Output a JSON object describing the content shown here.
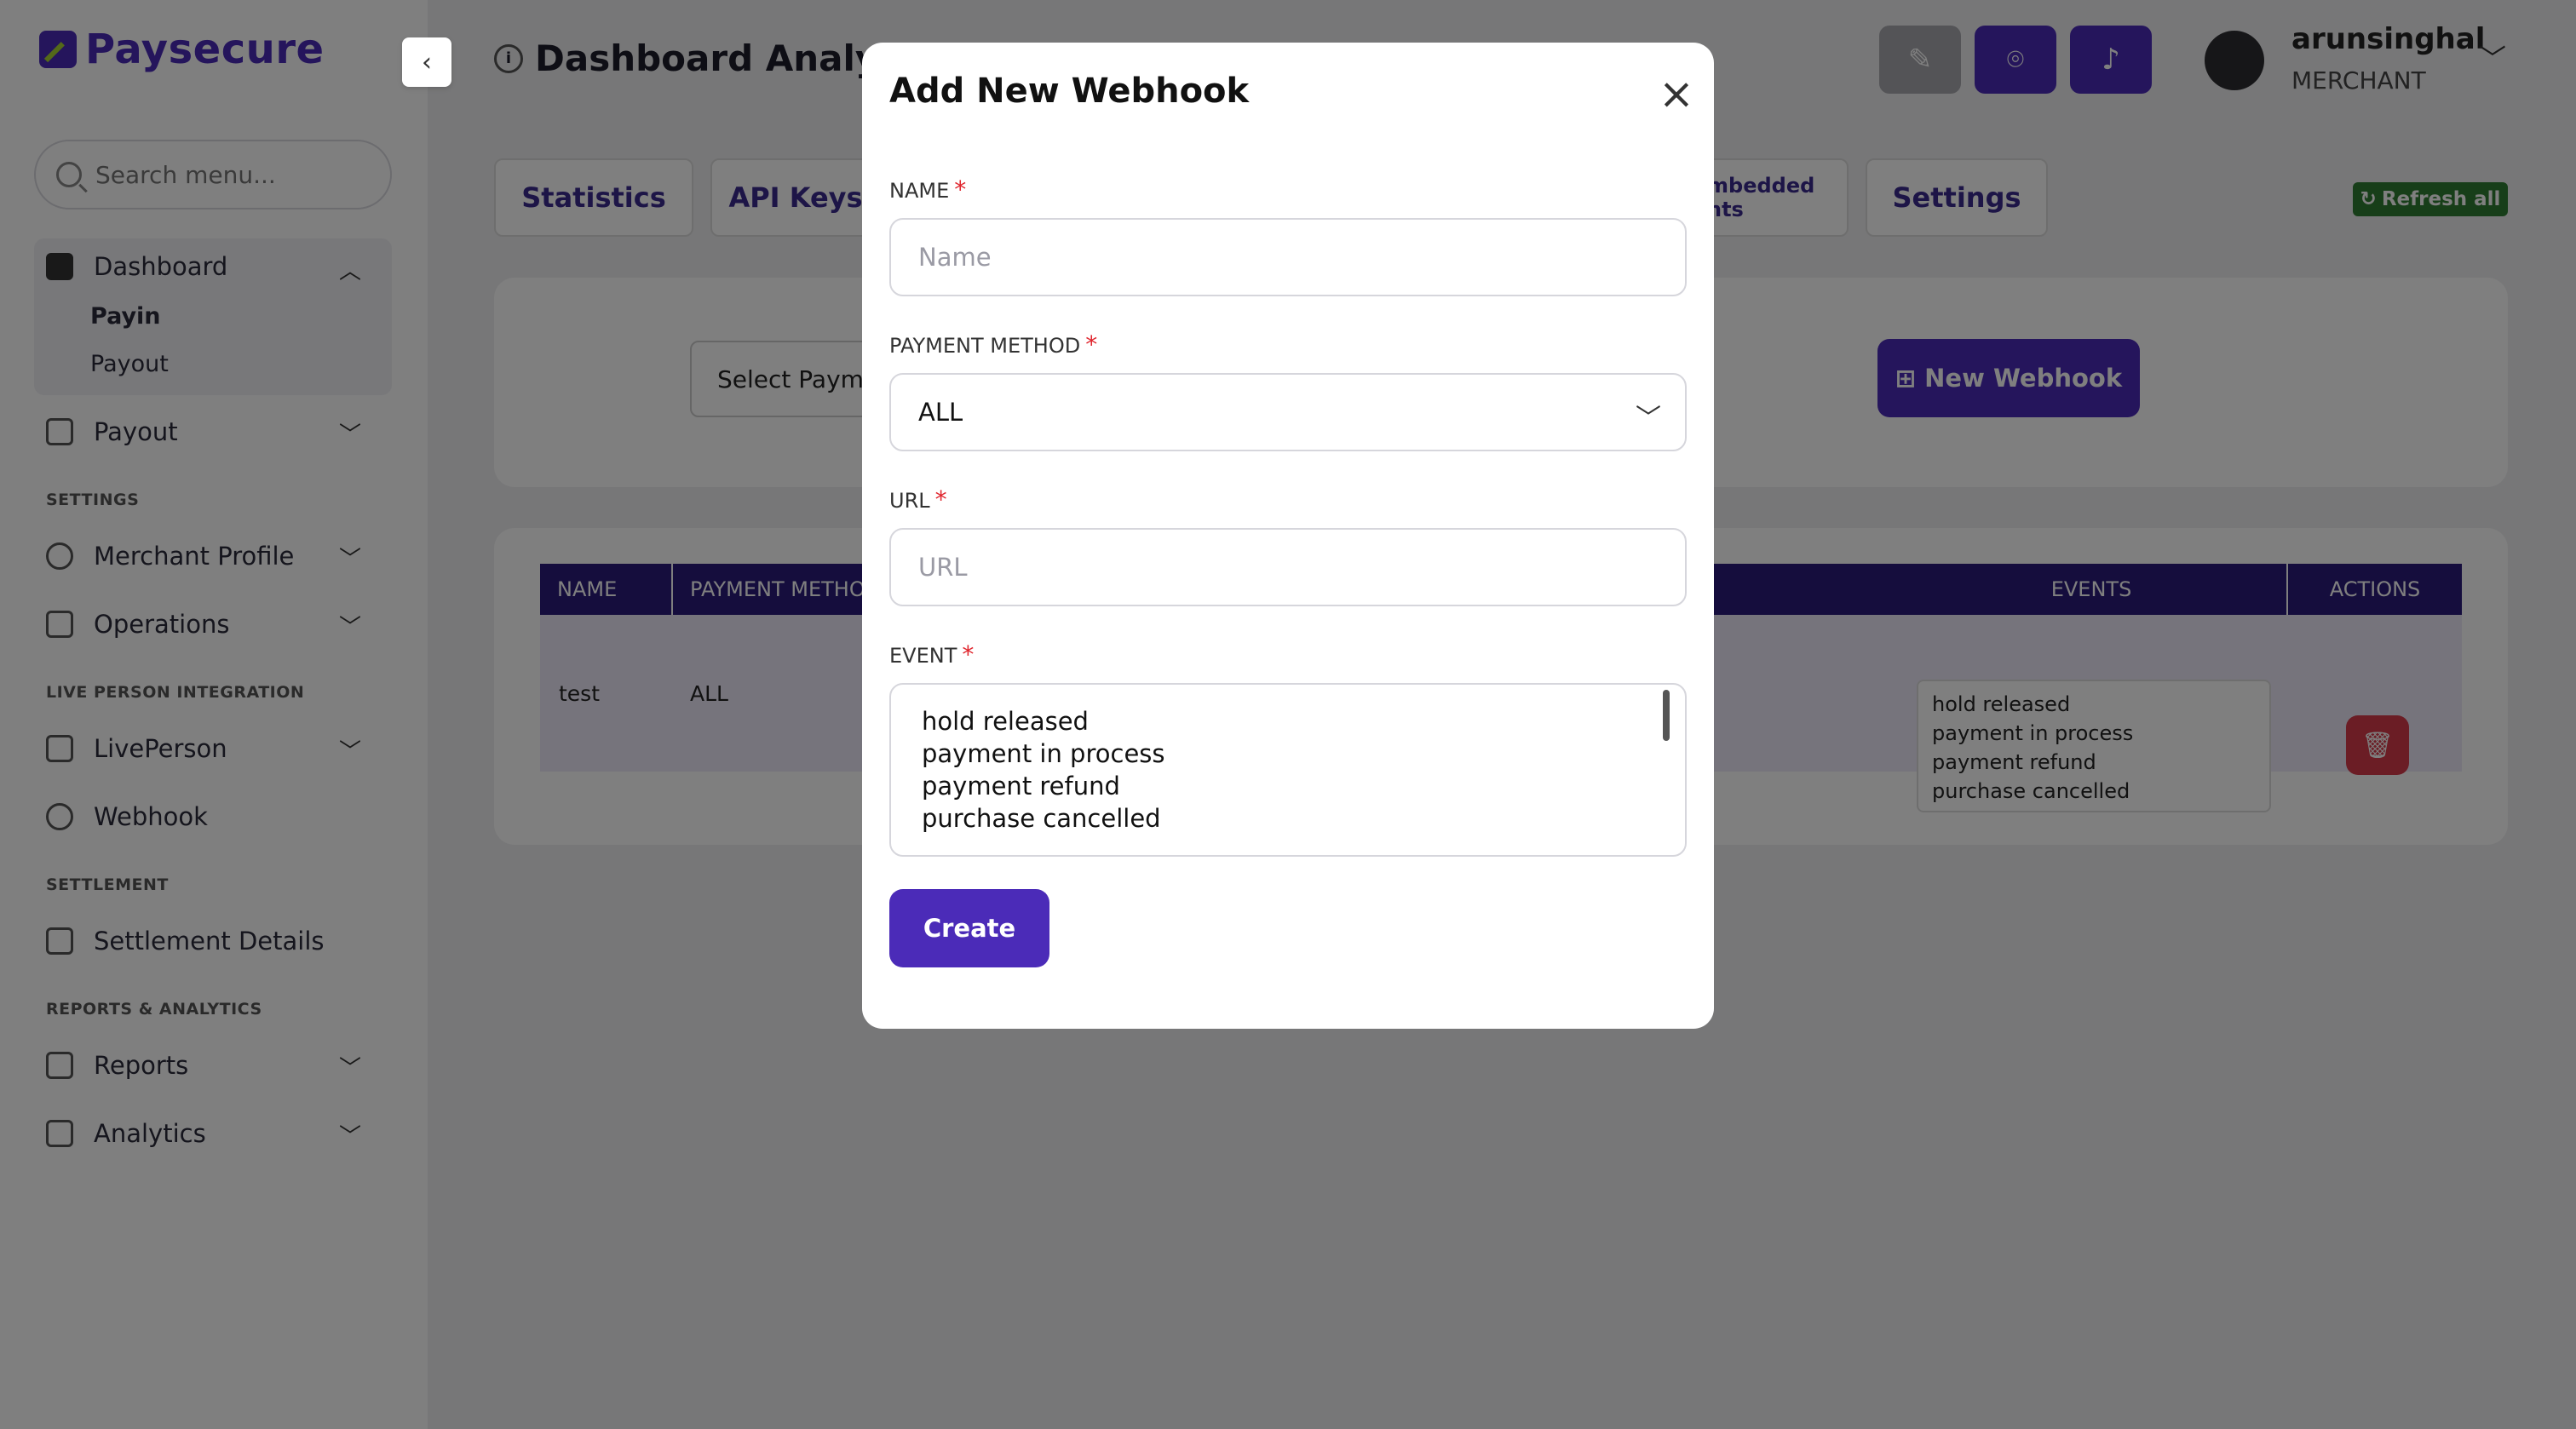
{
  "brand": {
    "name": "Paysecure",
    "accent": "#4b2bb8"
  },
  "sidebar": {
    "search_placeholder": "Search menu...",
    "dashboard": {
      "label": "Dashboard",
      "sub": [
        "Payin",
        "Payout"
      ]
    },
    "payout_label": "Payout",
    "section_settings": "SETTINGS",
    "merchant_profile": "Merchant Profile",
    "operations": "Operations",
    "section_live": "LIVE PERSON INTEGRATION",
    "liveperson": "LivePerson",
    "webhook": "Webhook",
    "section_settlement": "SETTLEMENT",
    "settlement_details": "Settlement Details",
    "section_reports": "REPORTS & ANALYTICS",
    "reports": "Reports",
    "analytics": "Analytics"
  },
  "header": {
    "title": "Dashboard Analytics",
    "user_name": "arunsinghal",
    "user_role": "MERCHANT"
  },
  "tabs": {
    "statistics": "Statistics",
    "api_keys": "API Keys",
    "embedded": "mbedded",
    "embedded2": "nts",
    "settings": "Settings",
    "refresh": "Refresh all"
  },
  "filters": {
    "select_payment": "Select Payme",
    "new_webhook": "New Webhook"
  },
  "table": {
    "headers": {
      "name": "NAME",
      "payment_method": "PAYMENT METHOD",
      "events": "EVENTS",
      "actions": "ACTIONS"
    },
    "row": {
      "name": "test",
      "payment_method": "ALL",
      "events": [
        "hold released",
        "payment in process",
        "payment refund",
        "purchase cancelled"
      ]
    }
  },
  "modal": {
    "title": "Add New Webhook",
    "name_label": "NAME",
    "name_placeholder": "Name",
    "payment_label": "PAYMENT METHOD",
    "payment_value": "ALL",
    "url_label": "URL",
    "url_placeholder": "URL",
    "event_label": "EVENT",
    "events": [
      "hold released",
      "payment in process",
      "payment refund",
      "purchase cancelled"
    ],
    "create_label": "Create",
    "required_mark": "*"
  },
  "icons": [
    "search-icon",
    "dashboard-icon",
    "payout-icon",
    "user-icon",
    "operations-icon",
    "liveperson-icon",
    "webhook-icon",
    "settlement-icon",
    "reports-icon",
    "analytics-icon",
    "chevron-down-icon",
    "chevron-up-icon",
    "close-icon",
    "trash-icon",
    "bell-icon",
    "scan-icon",
    "brush-icon",
    "info-icon",
    "refresh-icon",
    "plus-square-icon"
  ]
}
